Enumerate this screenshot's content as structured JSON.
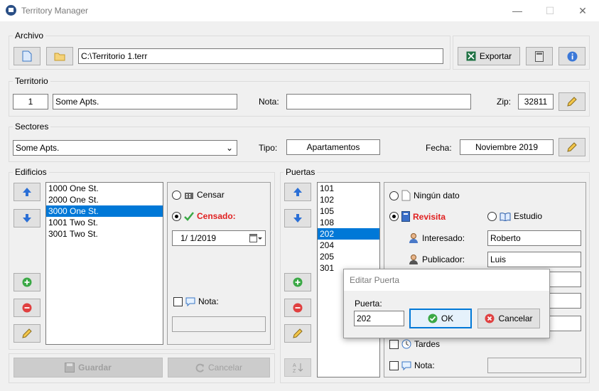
{
  "window": {
    "title": "Territory Manager",
    "minimize": "—",
    "maximize": "☐",
    "close": "✕"
  },
  "archivo": {
    "label": "Archivo",
    "path": "C:\\Territorio 1.terr",
    "exportar": "Exportar"
  },
  "territorio": {
    "label": "Territorio",
    "numero": "1",
    "nombre": "Some Apts.",
    "nota_label": "Nota:",
    "nota": "",
    "zip_label": "Zip:",
    "zip": "32811"
  },
  "sectores": {
    "label": "Sectores",
    "selected": "Some Apts.",
    "tipo_label": "Tipo:",
    "tipo": "Apartamentos",
    "fecha_label": "Fecha:",
    "fecha": "Noviembre 2019"
  },
  "edificios": {
    "label": "Edificios",
    "items": [
      "1000 One St.",
      "2000 One St.",
      "3000 One St.",
      "1001 Two St.",
      "3001 Two St."
    ],
    "selected_index": 2,
    "censar": "Censar",
    "censado": "Censado:",
    "date": "1/  1/2019",
    "nota_label": "Nota:",
    "guardar": "Guardar",
    "cancelar": "Cancelar"
  },
  "puertas": {
    "label": "Puertas",
    "items": [
      "101",
      "102",
      "105",
      "108",
      "202",
      "204",
      "205",
      "301"
    ],
    "selected_index": 4,
    "ningun": "Ningún dato",
    "revisita": "Revisita",
    "estudio": "Estudio",
    "interesado_label": "Interesado:",
    "interesado": "Roberto",
    "publicador_label": "Publicador:",
    "publicador": "Luis",
    "tardes": "Tardes",
    "nota_label": "Nota:"
  },
  "dialog": {
    "title": "Editar Puerta",
    "puerta_label": "Puerta:",
    "puerta": "202",
    "ok": "OK",
    "cancelar": "Cancelar"
  }
}
